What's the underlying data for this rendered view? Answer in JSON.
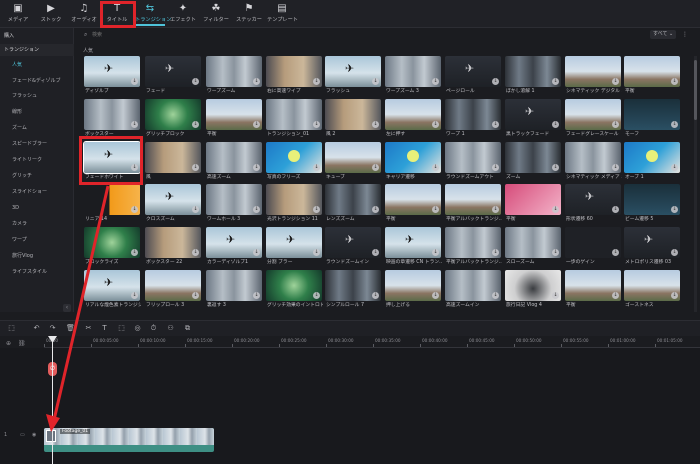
{
  "toolbar": {
    "tabs": [
      {
        "label": "メディア",
        "icon": "folder-icon"
      },
      {
        "label": "ストック",
        "icon": "stock-icon"
      },
      {
        "label": "オーディオ",
        "icon": "music-icon"
      },
      {
        "label": "タイトル",
        "icon": "title-icon"
      },
      {
        "label": "トランジション",
        "icon": "transition-icon",
        "active": true
      },
      {
        "label": "エフェクト",
        "icon": "effect-icon"
      },
      {
        "label": "フィルター",
        "icon": "filter-icon"
      },
      {
        "label": "ステッカー",
        "icon": "sticker-icon"
      },
      {
        "label": "テンプレート",
        "icon": "template-icon"
      }
    ]
  },
  "sidebar": {
    "items": [
      {
        "label": "購入",
        "group": true
      },
      {
        "label": "トランジション",
        "group": true
      },
      {
        "label": "人気",
        "selected": true
      },
      {
        "label": "フェード&ディゾルブ"
      },
      {
        "label": "フラッシュ"
      },
      {
        "label": "線形"
      },
      {
        "label": "ズーム"
      },
      {
        "label": "スピードブラー"
      },
      {
        "label": "ライトリーク"
      },
      {
        "label": "グリッチ"
      },
      {
        "label": "スライドショー"
      },
      {
        "label": "3D"
      },
      {
        "label": "カメラ"
      },
      {
        "label": "ワープ"
      },
      {
        "label": "旅行Vlog"
      },
      {
        "label": "ライフスタイル"
      }
    ]
  },
  "search": {
    "placeholder": "検索"
  },
  "filter": {
    "label": "すべて ⌄",
    "menu": "⋮"
  },
  "section_title": "人気",
  "cards": [
    {
      "label": "ディゾルブ",
      "theme": "t-sky"
    },
    {
      "label": "フェード",
      "theme": "t-dark"
    },
    {
      "label": "ワープズーム",
      "theme": "t-city"
    },
    {
      "label": "右に高速ワイプ",
      "theme": "t-blur"
    },
    {
      "label": "フラッシュ",
      "theme": "t-sky"
    },
    {
      "label": "ワープズーム 3",
      "theme": "t-city"
    },
    {
      "label": "ページロール",
      "theme": "t-dark"
    },
    {
      "label": "ぼかし溶解 1",
      "theme": "t-city-dark"
    },
    {
      "label": "シネマティック デジタル ス...",
      "theme": "t-house"
    },
    {
      "label": "平衡",
      "theme": "t-house"
    },
    {
      "label": "ボックスター",
      "theme": "t-city"
    },
    {
      "label": "グリッチブロック",
      "theme": "t-green"
    },
    {
      "label": "平衡",
      "theme": "t-house"
    },
    {
      "label": "トランジション_01",
      "theme": "t-city"
    },
    {
      "label": "風 2",
      "theme": "t-blur"
    },
    {
      "label": "左に押す",
      "theme": "t-house"
    },
    {
      "label": "ワープ 1",
      "theme": "t-city-dark"
    },
    {
      "label": "黒トラックフェード",
      "theme": "t-dark"
    },
    {
      "label": "フェードグレースケール",
      "theme": "t-house"
    },
    {
      "label": "モーフ",
      "theme": "t-teal"
    },
    {
      "label": "フェードホワイト",
      "theme": "t-sky",
      "selected": true
    },
    {
      "label": "風",
      "theme": "t-blur"
    },
    {
      "label": "高速ズーム",
      "theme": "t-city"
    },
    {
      "label": "写真のフリーズ",
      "theme": "t-ball"
    },
    {
      "label": "キューブ",
      "theme": "t-house"
    },
    {
      "label": "キャリア遷移",
      "theme": "t-ball"
    },
    {
      "label": "ラウンドズームアウト",
      "theme": "t-city"
    },
    {
      "label": "ズーム",
      "theme": "t-city-dark"
    },
    {
      "label": "シネマティック メディア ネ...",
      "theme": "t-city"
    },
    {
      "label": "オーブ 1",
      "theme": "t-ball"
    },
    {
      "label": "リニア 14",
      "theme": "t-orange"
    },
    {
      "label": "クロスズーム",
      "theme": "t-sky"
    },
    {
      "label": "ワームホール 3",
      "theme": "t-city"
    },
    {
      "label": "光沢トランジション 11",
      "theme": "t-blur"
    },
    {
      "label": "レンズズーム",
      "theme": "t-city-dark"
    },
    {
      "label": "平衡",
      "theme": "t-house"
    },
    {
      "label": "平衡アルバックトランジ...",
      "theme": "t-house"
    },
    {
      "label": "平衡",
      "theme": "t-pink"
    },
    {
      "label": "形状遷移 60",
      "theme": "t-dark"
    },
    {
      "label": "ビーム遷移 5",
      "theme": "t-teal"
    },
    {
      "label": "ブロックライズ",
      "theme": "t-green"
    },
    {
      "label": "ボックスター 22",
      "theme": "t-blur"
    },
    {
      "label": "カラーディゾルブ1",
      "theme": "t-sky"
    },
    {
      "label": "分割 ブラー",
      "theme": "t-sky"
    },
    {
      "label": "ラウンドズームイン",
      "theme": "t-dark"
    },
    {
      "label": "映画の章遷移 CN トラン...",
      "theme": "t-sky"
    },
    {
      "label": "平衡アルバックトランジ...",
      "theme": "t-city"
    },
    {
      "label": "スローズーム",
      "theme": "t-city"
    },
    {
      "label": "一歩のゲイン",
      "theme": "t-wave"
    },
    {
      "label": "メトロポリス遷移 03",
      "theme": "t-dark"
    },
    {
      "label": "リアルな煙色素トランジシ...",
      "theme": "t-sky"
    },
    {
      "label": "フリップロール 3",
      "theme": "t-house"
    },
    {
      "label": "裏返す 3",
      "theme": "t-city"
    },
    {
      "label": "グリッチ効果のイントロト...",
      "theme": "t-green"
    },
    {
      "label": "シンプルロール 7",
      "theme": "t-city-dark"
    },
    {
      "label": "押し上げる",
      "theme": "t-house"
    },
    {
      "label": "高速ズームイン",
      "theme": "t-city"
    },
    {
      "label": "旅行日記 Vlog 4",
      "theme": "t-smoke"
    },
    {
      "label": "平衡",
      "theme": "t-house"
    },
    {
      "label": "ゴーストネス",
      "theme": "t-house"
    }
  ],
  "timeline": {
    "tools": [
      "↶",
      "↷",
      "🗑",
      "✂",
      "T",
      "⬚",
      "◎",
      "⏱",
      "⚇",
      "⧉"
    ],
    "ruler": [
      "00:00",
      "00:00:05:00",
      "00:00:10:00",
      "00:00:15:00",
      "00:00:20:00",
      "00:00:25:00",
      "00:00:30:00",
      "00:00:35:00",
      "00:00:40:00",
      "00:00:45:00",
      "00:00:50:00",
      "00:00:55:00",
      "00:01:00:00",
      "00:01:05:00"
    ],
    "clip_name": "Footage_01",
    "track_number": "1",
    "marker_icon": "∅"
  },
  "colors": {
    "accent": "#4fc3d9",
    "highlight": "#e0242a",
    "clip": "#3e8f84"
  }
}
